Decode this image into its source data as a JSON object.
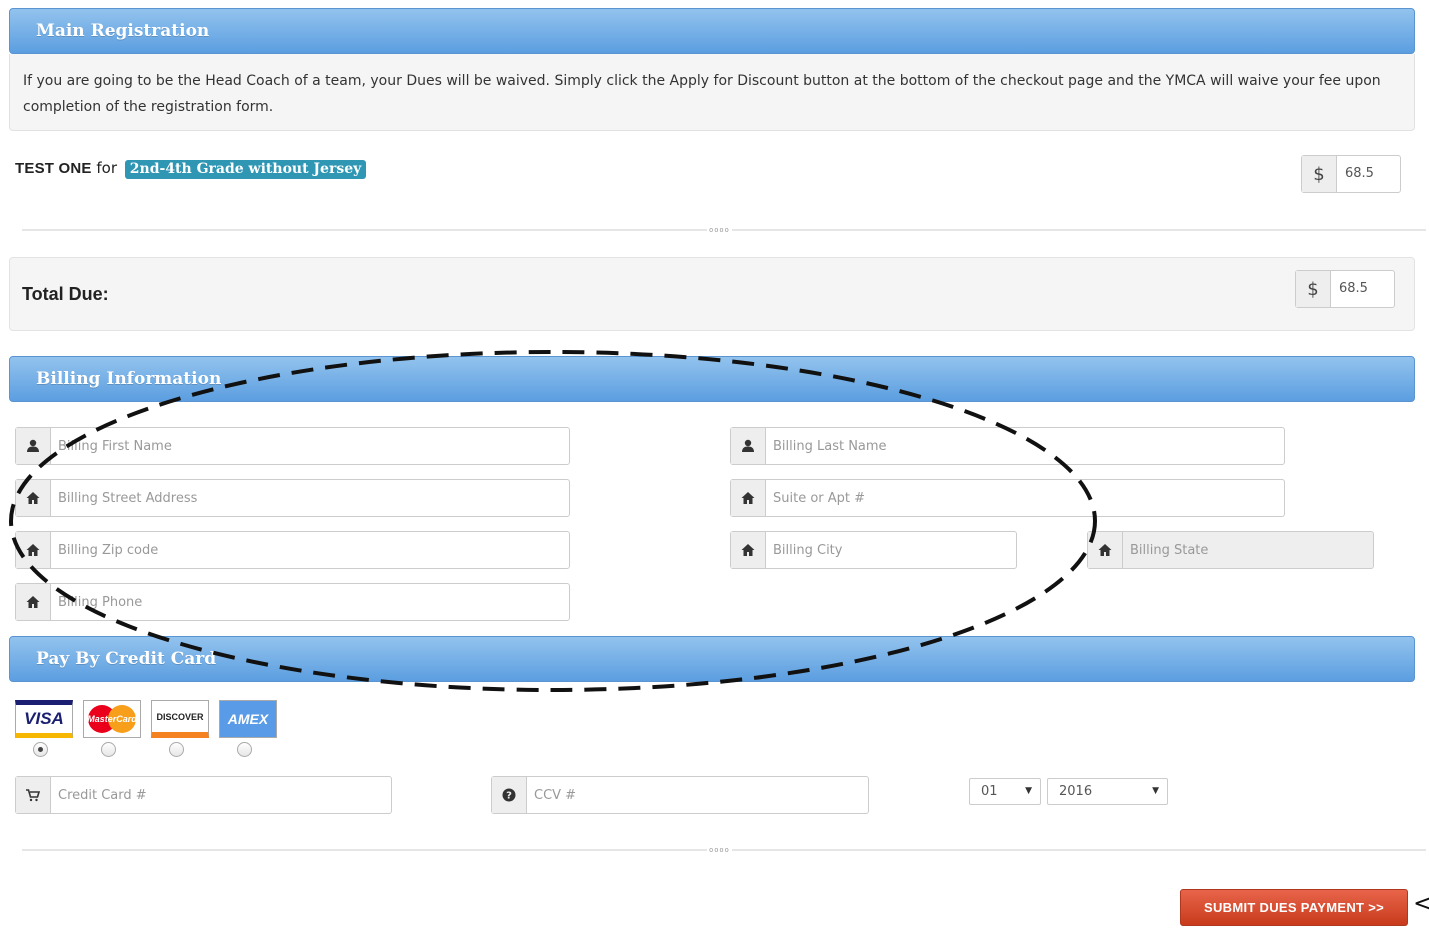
{
  "main_registration": {
    "title": "Main Registration",
    "notice": "If you are going to be the Head Coach of a team, your Dues will be waived. Simply click the Apply for Discount button at the bottom of the checkout page and the YMCA will waive your fee upon completion of the registration form."
  },
  "registrant": {
    "name": "TEST ONE",
    "for_word": "for",
    "program": "2nd-4th Grade without Jersey",
    "currency": "$",
    "amount": "68.5"
  },
  "total": {
    "label": "Total Due:",
    "currency": "$",
    "amount": "68.5"
  },
  "billing": {
    "title": "Billing Information",
    "first_name_placeholder": "Billing First Name",
    "last_name_placeholder": "Billing Last Name",
    "street_placeholder": "Billing Street Address",
    "suite_placeholder": "Suite or Apt #",
    "zip_placeholder": "Billing Zip code",
    "city_placeholder": "Billing City",
    "state_placeholder": "Billing State",
    "phone_placeholder": "Billing Phone"
  },
  "payment": {
    "title": "Pay By Credit Card",
    "cards": [
      {
        "label": "VISA",
        "selected": true
      },
      {
        "label": "MasterCard",
        "selected": false
      },
      {
        "label": "DISCOVER",
        "selected": false
      },
      {
        "label": "AMEX",
        "selected": false
      }
    ],
    "card_number_placeholder": "Credit Card #",
    "ccv_placeholder": "CCV #",
    "exp_month": "01",
    "exp_year": "2016"
  },
  "submit_label": "SUBMIT DUES PAYMENT >>",
  "divider_grip": "oooo",
  "annotation_arrow": "<",
  "colors": {
    "header_gradient_top": "#93c3ee",
    "header_gradient_bottom": "#5b9ee0",
    "program_badge": "#2f96b4",
    "submit_button": "#d94a2c"
  }
}
